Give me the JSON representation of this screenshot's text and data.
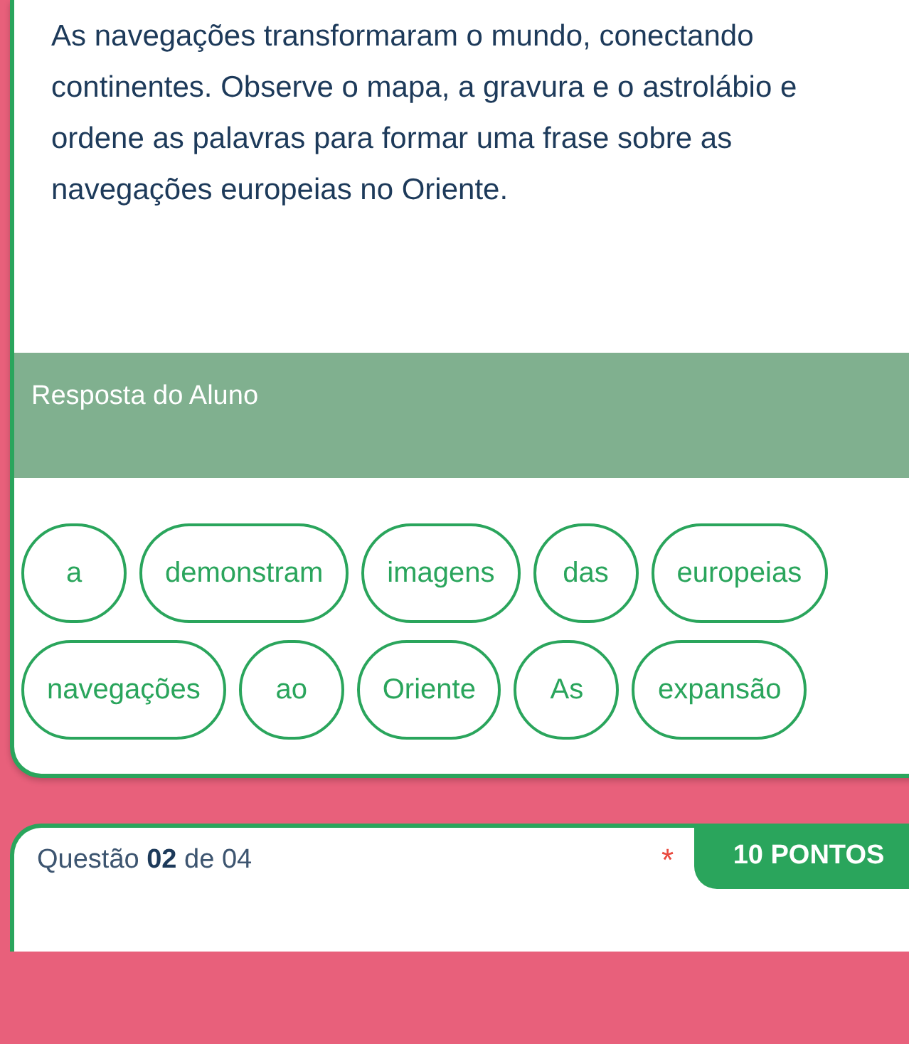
{
  "question": {
    "text": "As navegações transformaram o mundo, conectando continentes. Observe o mapa, a gravura e o astrolábio e ordene as palavras para formar uma frase sobre as navegações europeias no Oriente."
  },
  "answer": {
    "title": "Resposta do Aluno",
    "words": [
      {
        "label": "a"
      },
      {
        "label": "demonstram"
      },
      {
        "label": "imagens"
      },
      {
        "label": "das"
      },
      {
        "label": "europeias"
      },
      {
        "label": "navegações"
      },
      {
        "label": "ao"
      },
      {
        "label": "Oriente"
      },
      {
        "label": "As"
      },
      {
        "label": "expansão"
      }
    ]
  },
  "next_question": {
    "counter": "Questão **02** de 04",
    "required_mark": "*",
    "points": "10 PONTOS"
  }
}
